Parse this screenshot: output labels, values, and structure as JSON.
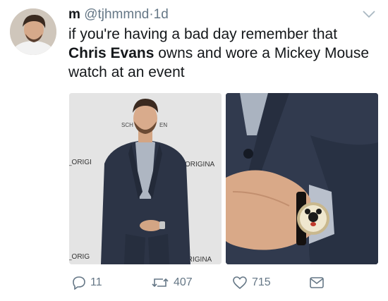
{
  "tweet": {
    "author_name": "m",
    "handle": "@tjhmmnd",
    "separator": "·",
    "time": "1d",
    "text_part1": "if you're having a bad day remember that ",
    "text_bold": "Chris Evans",
    "text_part2": " owns and wore a Mickey Mouse watch at an event"
  },
  "photo_backdrop": {
    "logo_left": "SCH",
    "logo_right": "EN",
    "word_top_left": "_ORIGI",
    "word_top_right": "ORIGINA",
    "word_bottom_left": "_ORIG",
    "word_bottom_right": "ORIGINA"
  },
  "actions": {
    "reply_count": "11",
    "retweet_count": "407",
    "like_count": "715"
  },
  "colors": {
    "text": "#14171a",
    "muted": "#657786",
    "suit": "#2c3446"
  }
}
